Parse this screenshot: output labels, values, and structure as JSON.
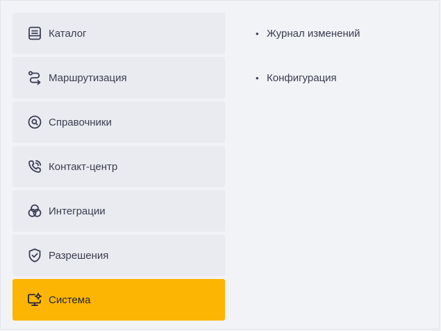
{
  "menu": {
    "items": [
      {
        "label": "Каталог",
        "icon": "catalog-icon"
      },
      {
        "label": "Маршрутизация",
        "icon": "route-icon"
      },
      {
        "label": "Справочники",
        "icon": "reference-search-icon"
      },
      {
        "label": "Контакт-центр",
        "icon": "phone-call-icon"
      },
      {
        "label": "Интеграции",
        "icon": "integrations-icon"
      },
      {
        "label": "Разрешения",
        "icon": "shield-check-icon"
      },
      {
        "label": "Система",
        "icon": "monitor-settings-icon",
        "active": true
      }
    ]
  },
  "submenu": {
    "items": [
      {
        "label": "Журнал изменений"
      },
      {
        "label": "Конфигурация"
      }
    ]
  },
  "colors": {
    "active_bg": "#fdb503",
    "item_bg": "#eaebf0",
    "page_bg": "#f2f3f7",
    "icon": "#3a3d55"
  }
}
